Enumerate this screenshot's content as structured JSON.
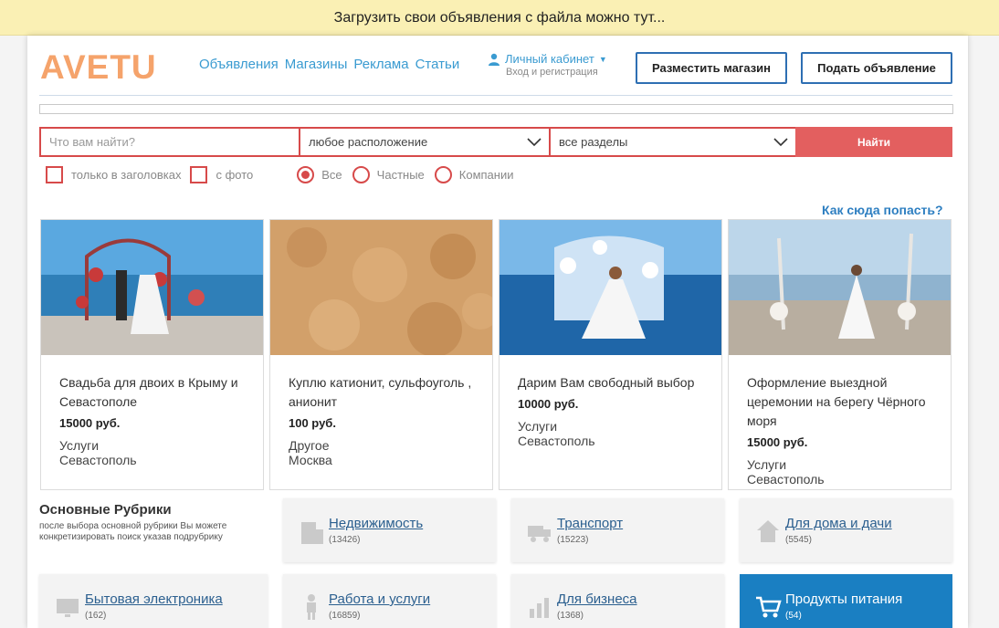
{
  "banner": {
    "text": "Загрузить свои объявления с файла можно тут..."
  },
  "header": {
    "logo": "AVETU",
    "nav": [
      "Объявления",
      "Магазины",
      "Реклама",
      "Статьи"
    ],
    "cabinet": {
      "label": "Личный кабинет",
      "sub": "Вход и регистрация"
    },
    "shop_button": "Разместить магазин",
    "ad_button": "Подать объявление"
  },
  "search": {
    "placeholder": "Что вам найти?",
    "location": "любое расположение",
    "section": "все разделы",
    "submit": "Найти"
  },
  "filters": {
    "titles_only": "только в заголовках",
    "with_photo": "с фото",
    "radios": [
      "Все",
      "Частные",
      "Компании"
    ],
    "selected_radio": "Все"
  },
  "how_to": "Как сюда попасть?",
  "cards": [
    {
      "title": "Свадьба для двоих в Крыму и Севастополе",
      "price": "15000 руб.",
      "category": "Услуги",
      "city": "Севастополь"
    },
    {
      "title": "Куплю катионит, сульфоуголь , анионит",
      "price": "100 руб.",
      "category": "Другое",
      "city": "Москва"
    },
    {
      "title": "Дарим Вам свободный выбор",
      "price": "10000 руб.",
      "category": "Услуги",
      "city": "Севастополь"
    },
    {
      "title": "Оформление выездной церемонии на берегу Чёрного моря",
      "price": "15000 руб.",
      "category": "Услуги",
      "city": "Севастополь"
    }
  ],
  "rubrics": {
    "heading": "Основные Рубрики",
    "description": "после выбора основной рубрики Вы можете конкретизировать поиск указав подрубрику",
    "items": [
      {
        "name": "Недвижимость",
        "count": "(13426)",
        "icon": "building-icon"
      },
      {
        "name": "Транспорт",
        "count": "(15223)",
        "icon": "truck-icon"
      },
      {
        "name": "Для дома и дачи",
        "count": "(5545)",
        "icon": "house-icon"
      },
      {
        "name": "Бытовая электроника",
        "count": "(162)",
        "icon": "tv-icon"
      },
      {
        "name": "Работа и услуги",
        "count": "(16859)",
        "icon": "person-icon"
      },
      {
        "name": "Для бизнеса",
        "count": "(1368)",
        "icon": "chart-icon"
      },
      {
        "name": "Продукты питания",
        "count": "(54)",
        "icon": "cart-icon"
      }
    ]
  },
  "colors": {
    "accent_red": "#d74a4a",
    "link_blue": "#3a9bd1",
    "logo_orange": "#f5a36b",
    "active_tile": "#1a7fc2"
  }
}
